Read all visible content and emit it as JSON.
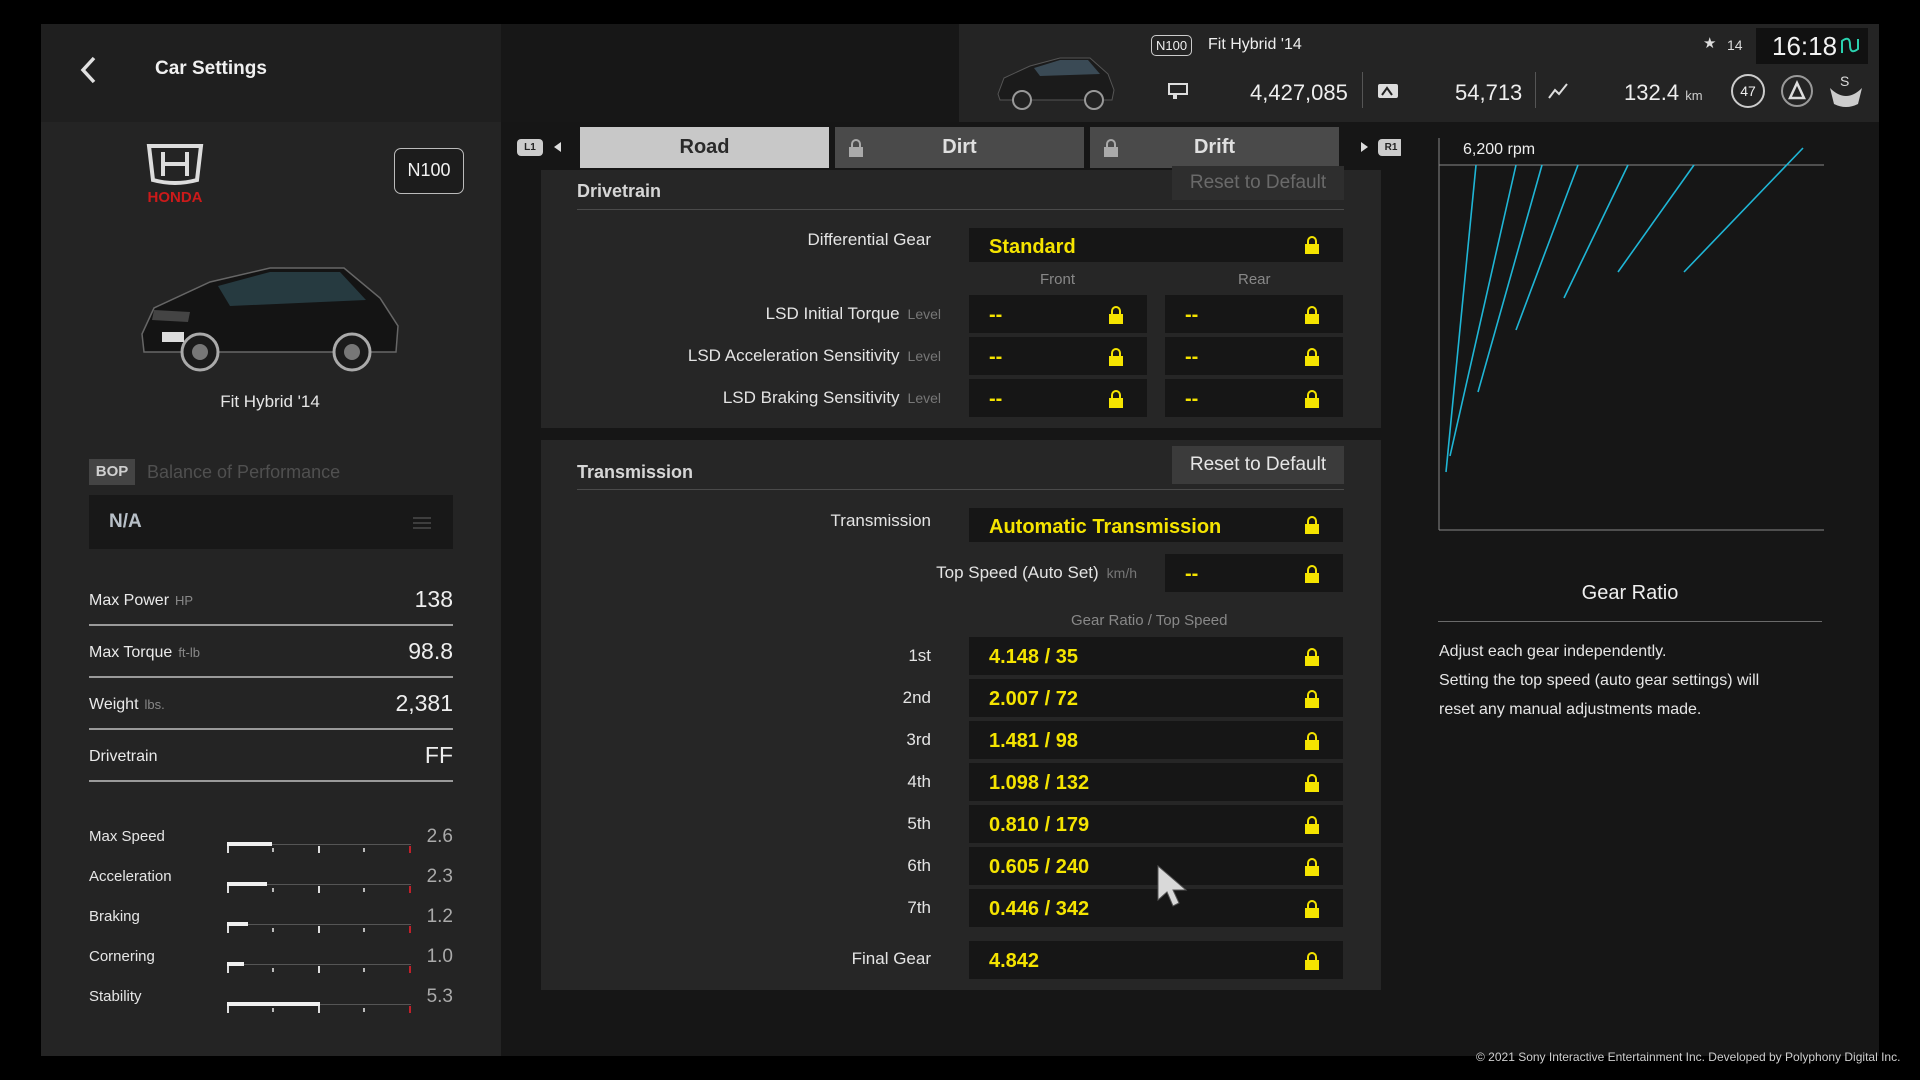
{
  "header": {
    "title": "Car Settings",
    "car_class": "N100",
    "car_name": "Fit Hybrid '14",
    "credits": "4,427,085",
    "mileage_points": "54,713",
    "distance": "132.4",
    "distance_unit": "km",
    "notifications": "14",
    "time": "16:18",
    "level": "47"
  },
  "car": {
    "make": "HONDA",
    "class_badge": "N100",
    "name": "Fit Hybrid '14",
    "bop_tag": "BOP",
    "bop_label": "Balance of Performance",
    "bop_value": "N/A"
  },
  "specs": [
    {
      "label": "Max Power",
      "unit": "HP",
      "value": "138"
    },
    {
      "label": "Max Torque",
      "unit": "ft-lb",
      "value": "98.8"
    },
    {
      "label": "Weight",
      "unit": "lbs.",
      "value": "2,381"
    },
    {
      "label": "Drivetrain",
      "unit": "",
      "value": "FF"
    }
  ],
  "ratings": [
    {
      "label": "Max Speed",
      "value": "2.6",
      "level": 2.6
    },
    {
      "label": "Acceleration",
      "value": "2.3",
      "level": 2.3
    },
    {
      "label": "Braking",
      "value": "1.2",
      "level": 1.2
    },
    {
      "label": "Cornering",
      "value": "1.0",
      "level": 1.0
    },
    {
      "label": "Stability",
      "value": "5.3",
      "level": 5.3
    }
  ],
  "tabs": {
    "l1": "L1",
    "r1": "R1",
    "items": [
      "Road",
      "Dirt",
      "Drift"
    ],
    "active": "Road"
  },
  "drivetrain": {
    "title": "Drivetrain",
    "reset": "Reset to Default",
    "diff_label": "Differential Gear",
    "diff_value": "Standard",
    "front": "Front",
    "rear": "Rear",
    "level_unit": "Level",
    "lsd": [
      {
        "label": "LSD Initial Torque",
        "front": "--",
        "rear": "--"
      },
      {
        "label": "LSD Acceleration Sensitivity",
        "front": "--",
        "rear": "--"
      },
      {
        "label": "LSD Braking Sensitivity",
        "front": "--",
        "rear": "--"
      }
    ]
  },
  "transmission": {
    "title": "Transmission",
    "reset": "Reset to Default",
    "trans_label": "Transmission",
    "trans_value": "Automatic Transmission",
    "top_speed_label": "Top Speed (Auto Set)",
    "top_speed_unit": "km/h",
    "top_speed_value": "--",
    "gear_header": "Gear Ratio / Top Speed",
    "gears": [
      {
        "label": "1st",
        "value": "4.148 / 35"
      },
      {
        "label": "2nd",
        "value": "2.007 / 72"
      },
      {
        "label": "3rd",
        "value": "1.481 / 98"
      },
      {
        "label": "4th",
        "value": "1.098 / 132"
      },
      {
        "label": "5th",
        "value": "0.810 / 179"
      },
      {
        "label": "6th",
        "value": "0.605 / 240"
      },
      {
        "label": "7th",
        "value": "0.446 / 342"
      }
    ],
    "final_label": "Final Gear",
    "final_value": "4.842"
  },
  "gear_panel": {
    "rpm_label": "6,200 rpm",
    "title": "Gear Ratio",
    "desc": [
      "Adjust each gear independently.",
      "Setting the top speed (auto gear settings) will",
      "reset any manual adjustments made."
    ]
  },
  "colors": {
    "accent_yellow": "#f5e400",
    "graph_line": "#1fb6d6",
    "tab_active": "#c8c8c8"
  },
  "copyright": "© 2021 Sony Interactive Entertainment Inc. Developed by Polyphony Digital Inc."
}
